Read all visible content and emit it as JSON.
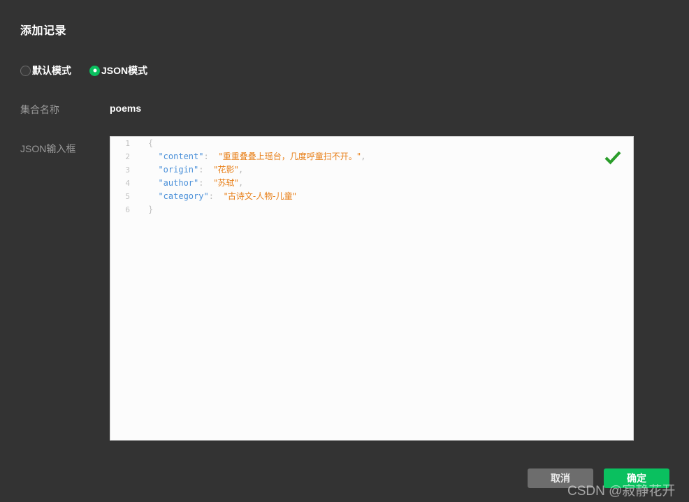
{
  "dialog": {
    "title": "添加记录"
  },
  "mode": {
    "options": [
      {
        "label": "默认模式",
        "selected": false
      },
      {
        "label": "JSON模式",
        "selected": true
      }
    ]
  },
  "fields": {
    "collection": {
      "label": "集合名称",
      "value": "poems"
    },
    "json_input": {
      "label": "JSON输入框"
    }
  },
  "editor": {
    "validation_icon": "check-icon",
    "validation_color": "#2a9d2a",
    "line_numbers": [
      "1",
      "2",
      "3",
      "4",
      "5",
      "6"
    ],
    "lines": [
      {
        "n": "1",
        "type": "brace_open",
        "text": "{"
      },
      {
        "n": "2",
        "type": "pair",
        "key": "\"content\"",
        "colon": ":",
        "value": "\"重重叠叠上瑶台，几度呼童扫不开。\"",
        "comma": ","
      },
      {
        "n": "3",
        "type": "pair",
        "key": "\"origin\"",
        "colon": ":",
        "value": "\"花影\"",
        "comma": ","
      },
      {
        "n": "4",
        "type": "pair",
        "key": "\"author\"",
        "colon": ":",
        "value": "\"苏轼\"",
        "comma": ","
      },
      {
        "n": "5",
        "type": "pair",
        "key": "\"category\"",
        "colon": ":",
        "value": "\"古诗文-人物-儿童\"",
        "comma": ""
      },
      {
        "n": "6",
        "type": "brace_close",
        "text": "}"
      }
    ]
  },
  "footer": {
    "cancel_label": "取消",
    "confirm_label": "确定"
  },
  "watermark": {
    "text": "CSDN @寂静花开"
  },
  "colors": {
    "background": "#333333",
    "accent_green": "#0ac05f",
    "editor_background": "#fcfcfc",
    "label_gray": "#9a9a9a",
    "json_key_blue": "#4a90d9",
    "json_string_orange": "#e8801a",
    "cancel_gray": "#6d6d6d"
  }
}
